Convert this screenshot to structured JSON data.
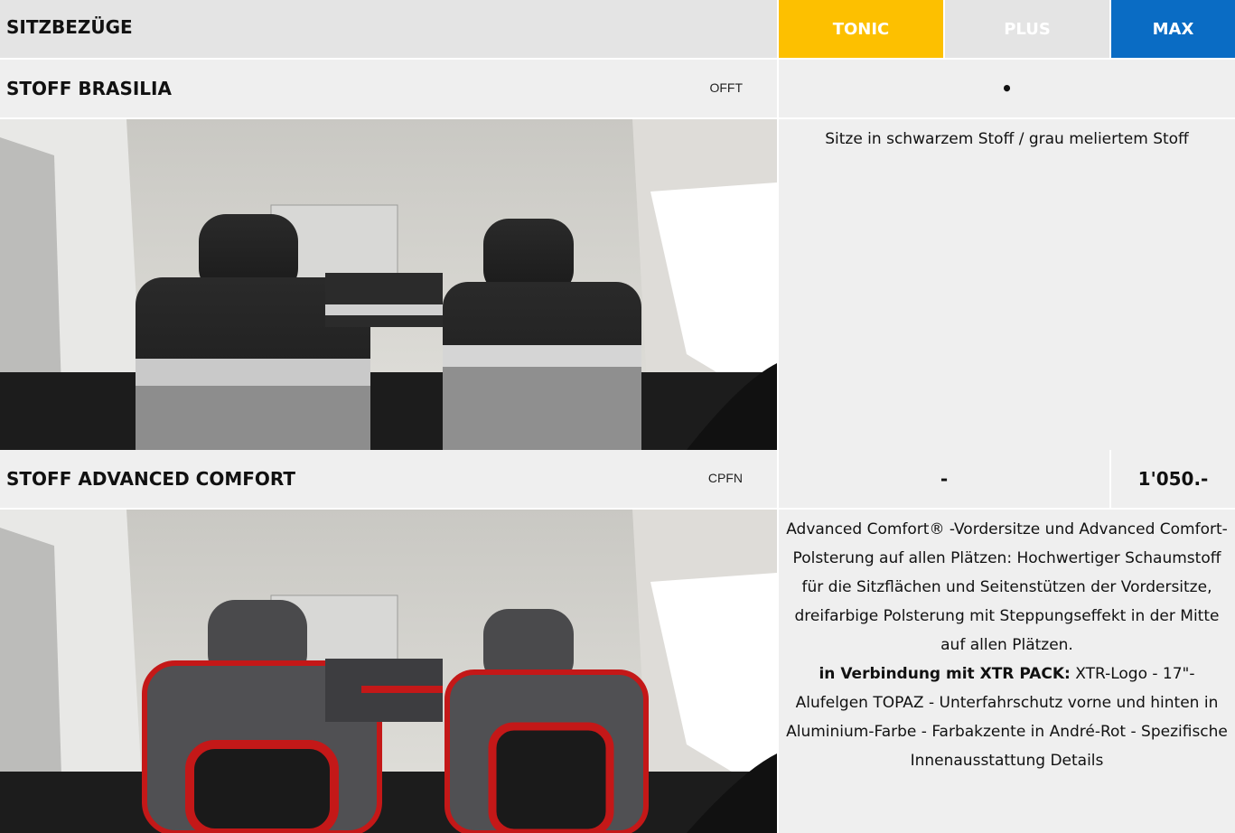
{
  "header": {
    "title": "SITZBEZÜGE",
    "tabs": [
      {
        "label": "TONIC",
        "color": "#fdc000"
      },
      {
        "label": "PLUS",
        "color": "#e4e4e4"
      },
      {
        "label": "MAX",
        "color": "#0a6cc4"
      }
    ]
  },
  "rows": [
    {
      "name": "STOFF BRASILIA",
      "code": "OFFT",
      "availability": "•",
      "description": "Sitze in schwarzem Stoff / grau meliertem Stoff",
      "image": "car-interior-fabric-brasilia"
    },
    {
      "name": "STOFF ADVANCED COMFORT",
      "code": "CPFN",
      "availability_plus": "-",
      "price_max": "1'050.-",
      "description_main": "Advanced Comfort® -Vordersitze und Advanced Comfort-Polsterung auf allen Plätzen: Hochwertiger Schaumstoff für die Sitzflächen und Seitenstützen der Vordersitze, dreifarbige Polsterung mit Steppungseffekt in der Mitte auf allen Plätzen.",
      "description_pack_label": "in Verbindung mit XTR PACK:",
      "description_pack": " XTR-Logo - 17\"-Alufelgen TOPAZ - Unterfahrschutz vorne und hinten in Aluminium-Farbe - Farbakzente in André-Rot - Spezifische Innenausstattung Details",
      "image": "car-interior-advanced-comfort"
    }
  ]
}
